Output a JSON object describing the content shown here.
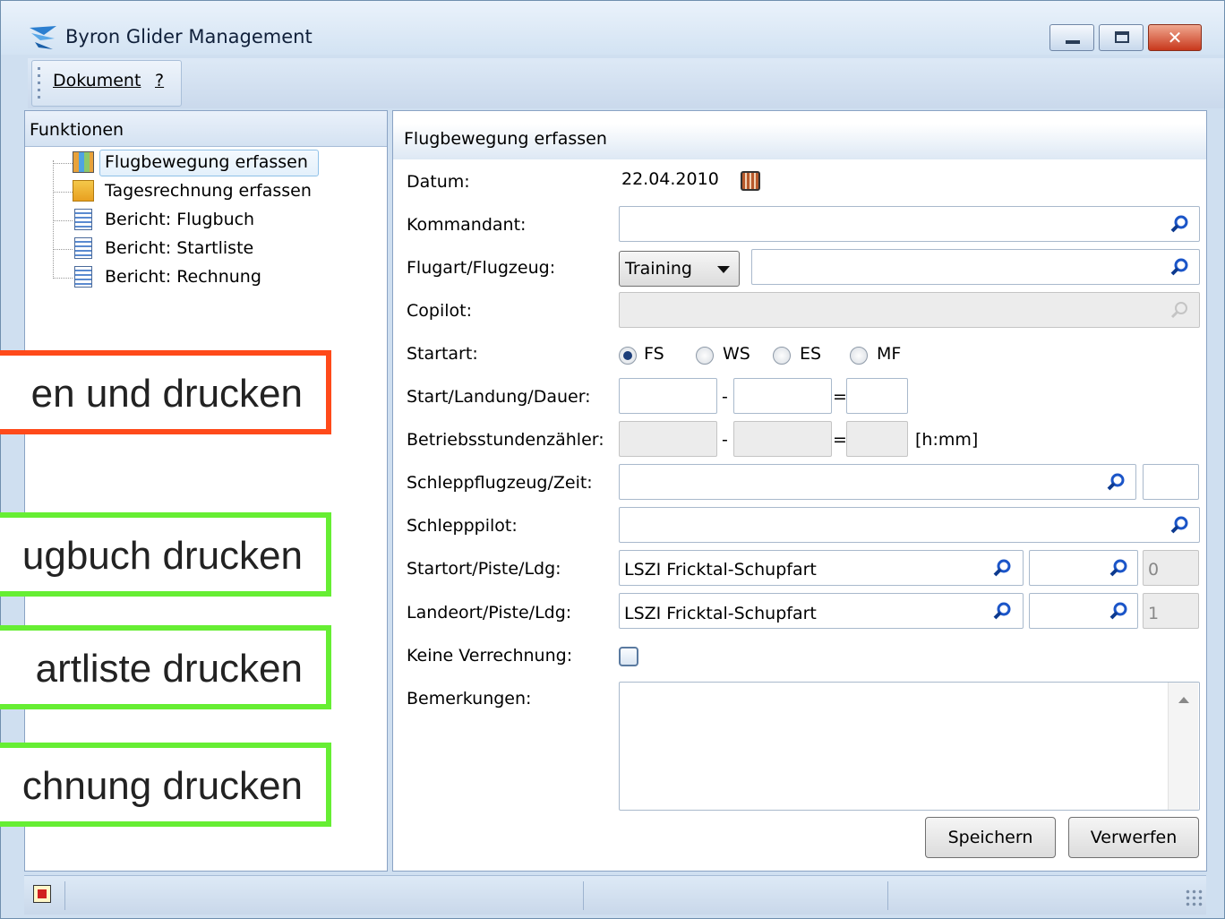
{
  "window": {
    "title": "Byron Glider Management"
  },
  "menu": {
    "items": [
      "Dokument",
      "?"
    ]
  },
  "left_panel": {
    "header": "Funktionen",
    "tree": [
      {
        "label": "Flugbewegung erfassen",
        "icon": "grid-icon",
        "selected": true
      },
      {
        "label": "Tagesrechnung erfassen",
        "icon": "folder-grid-icon"
      },
      {
        "label": "Bericht: Flugbuch",
        "icon": "report-icon"
      },
      {
        "label": "Bericht: Startliste",
        "icon": "report-icon"
      },
      {
        "label": "Bericht: Rechnung",
        "icon": "report-icon"
      }
    ]
  },
  "form": {
    "header": "Flugbewegung erfassen",
    "labels": {
      "datum": "Datum:",
      "kommandant": "Kommandant:",
      "flugart": "Flugart/Flugzeug:",
      "copilot": "Copilot:",
      "startart": "Startart:",
      "start_landung": "Start/Landung/Dauer:",
      "betriebsstunden": "Betriebsstundenzähler:",
      "schleppflugzeug": "Schleppflugzeug/Zeit:",
      "schlepppilot": "Schlepppilot:",
      "startort": "Startort/Piste/Ldg:",
      "landeort": "Landeort/Piste/Ldg:",
      "keine_verrechnung": "Keine Verrechnung:",
      "bemerkungen": "Bemerkungen:"
    },
    "datum_value": "22.04.2010",
    "flugart_value": "Training",
    "startart_options": [
      "FS",
      "WS",
      "ES",
      "MF"
    ],
    "startart_selected": "FS",
    "dash": "-",
    "equals": "=",
    "unit_hmm": "[h:mm]",
    "startort_value": "LSZI Fricktal-Schupfart",
    "startort_ldg": "0",
    "landeort_value": "LSZI Fricktal-Schupfart",
    "landeort_ldg": "1",
    "keine_verrechnung_checked": false,
    "buttons": {
      "save": "Speichern",
      "discard": "Verwerfen"
    }
  },
  "callouts": {
    "red": "en und drucken",
    "green": [
      "ugbuch drucken",
      "artliste drucken",
      "chnung drucken"
    ]
  },
  "colors": {
    "callout_red": "#ff4a1a",
    "callout_green": "#66ee33"
  }
}
